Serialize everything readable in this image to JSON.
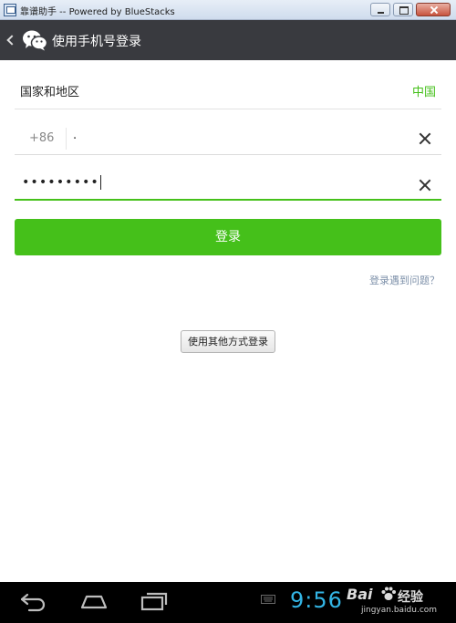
{
  "window": {
    "title": "靠谱助手 -- Powered by BlueStacks"
  },
  "header": {
    "title": "使用手机号登录"
  },
  "form": {
    "country_label": "国家和地区",
    "country_value": "中国",
    "phone_code": "+86",
    "phone_value": "·",
    "password_mask": "•••••••••",
    "login_label": "登录",
    "problem_link": "登录遇到问题？",
    "other_method_label": "使用其他方式登录"
  },
  "status": {
    "clock": "9:56"
  },
  "watermark": {
    "logo": "Bai",
    "text": "经验",
    "url": "jingyan.baidu.com"
  },
  "colors": {
    "accent": "#45c01a",
    "header_bg": "#393a3f",
    "clock": "#33b5e5"
  },
  "icons": [
    "back-arrow-icon",
    "wechat-icon",
    "clear-icon",
    "nav-back-icon",
    "nav-home-icon",
    "nav-recent-icon",
    "keyboard-icon"
  ]
}
